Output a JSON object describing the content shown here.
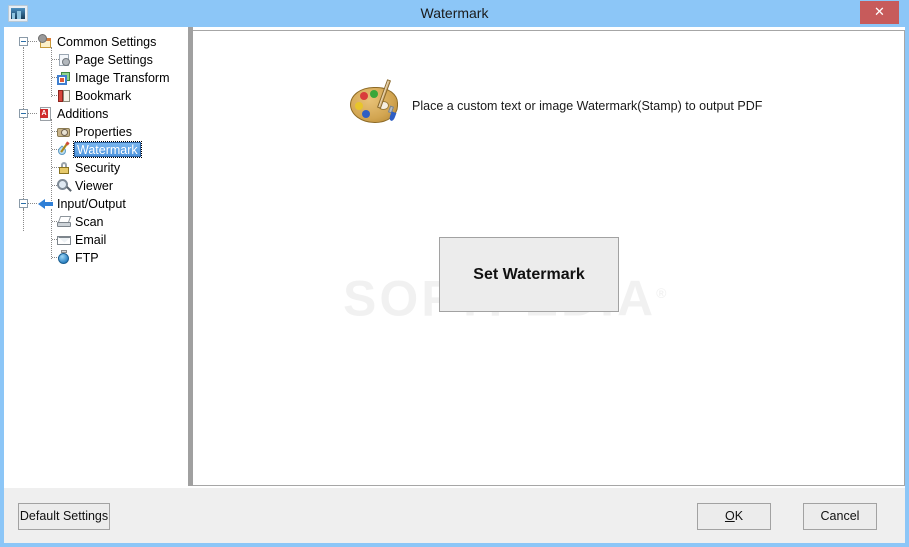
{
  "window": {
    "title": "Watermark",
    "app_icon": "image-icon",
    "close_label": "✕",
    "accent_titlebar": "#8cc6f7",
    "close_button_color": "#c75b5b"
  },
  "tree": {
    "nodes": [
      {
        "label": "Common Settings",
        "icon": "common-settings-icon",
        "level": 0,
        "expander": "collapse",
        "selected": false
      },
      {
        "label": "Page Settings",
        "icon": "page-settings-icon",
        "level": 1,
        "expander": "none",
        "selected": false
      },
      {
        "label": "Image Transform",
        "icon": "image-transform-icon",
        "level": 1,
        "expander": "none",
        "selected": false
      },
      {
        "label": "Bookmark",
        "icon": "bookmark-icon",
        "level": 1,
        "expander": "none",
        "selected": false
      },
      {
        "label": "Additions",
        "icon": "additions-pdf-icon",
        "level": 0,
        "expander": "collapse",
        "selected": false
      },
      {
        "label": "Properties",
        "icon": "properties-camera-icon",
        "level": 1,
        "expander": "none",
        "selected": false
      },
      {
        "label": "Watermark",
        "icon": "watermark-droplet-pencil-icon",
        "level": 1,
        "expander": "none",
        "selected": true
      },
      {
        "label": "Security",
        "icon": "security-padlock-icon",
        "level": 1,
        "expander": "none",
        "selected": false
      },
      {
        "label": "Viewer",
        "icon": "viewer-magnifier-icon",
        "level": 1,
        "expander": "none",
        "selected": false
      },
      {
        "label": "Input/Output",
        "icon": "input-output-arrow-icon",
        "level": 0,
        "expander": "collapse",
        "selected": false
      },
      {
        "label": "Scan",
        "icon": "scanner-icon",
        "level": 1,
        "expander": "none",
        "selected": false
      },
      {
        "label": "Email",
        "icon": "envelope-icon",
        "level": 1,
        "expander": "none",
        "selected": false
      },
      {
        "label": "FTP",
        "icon": "ftp-globe-icon",
        "level": 1,
        "expander": "none",
        "selected": false
      }
    ]
  },
  "content": {
    "header_icon": "paint-palette-icon",
    "description": "Place a custom text or image Watermark(Stamp) to output PDF",
    "set_watermark_label": "Set Watermark",
    "overlay_watermark": "SOFTPEDIA"
  },
  "footer": {
    "default_settings_label": "Default Settings",
    "ok_label_accel": "O",
    "ok_label_rest": "K",
    "cancel_label": "Cancel"
  }
}
